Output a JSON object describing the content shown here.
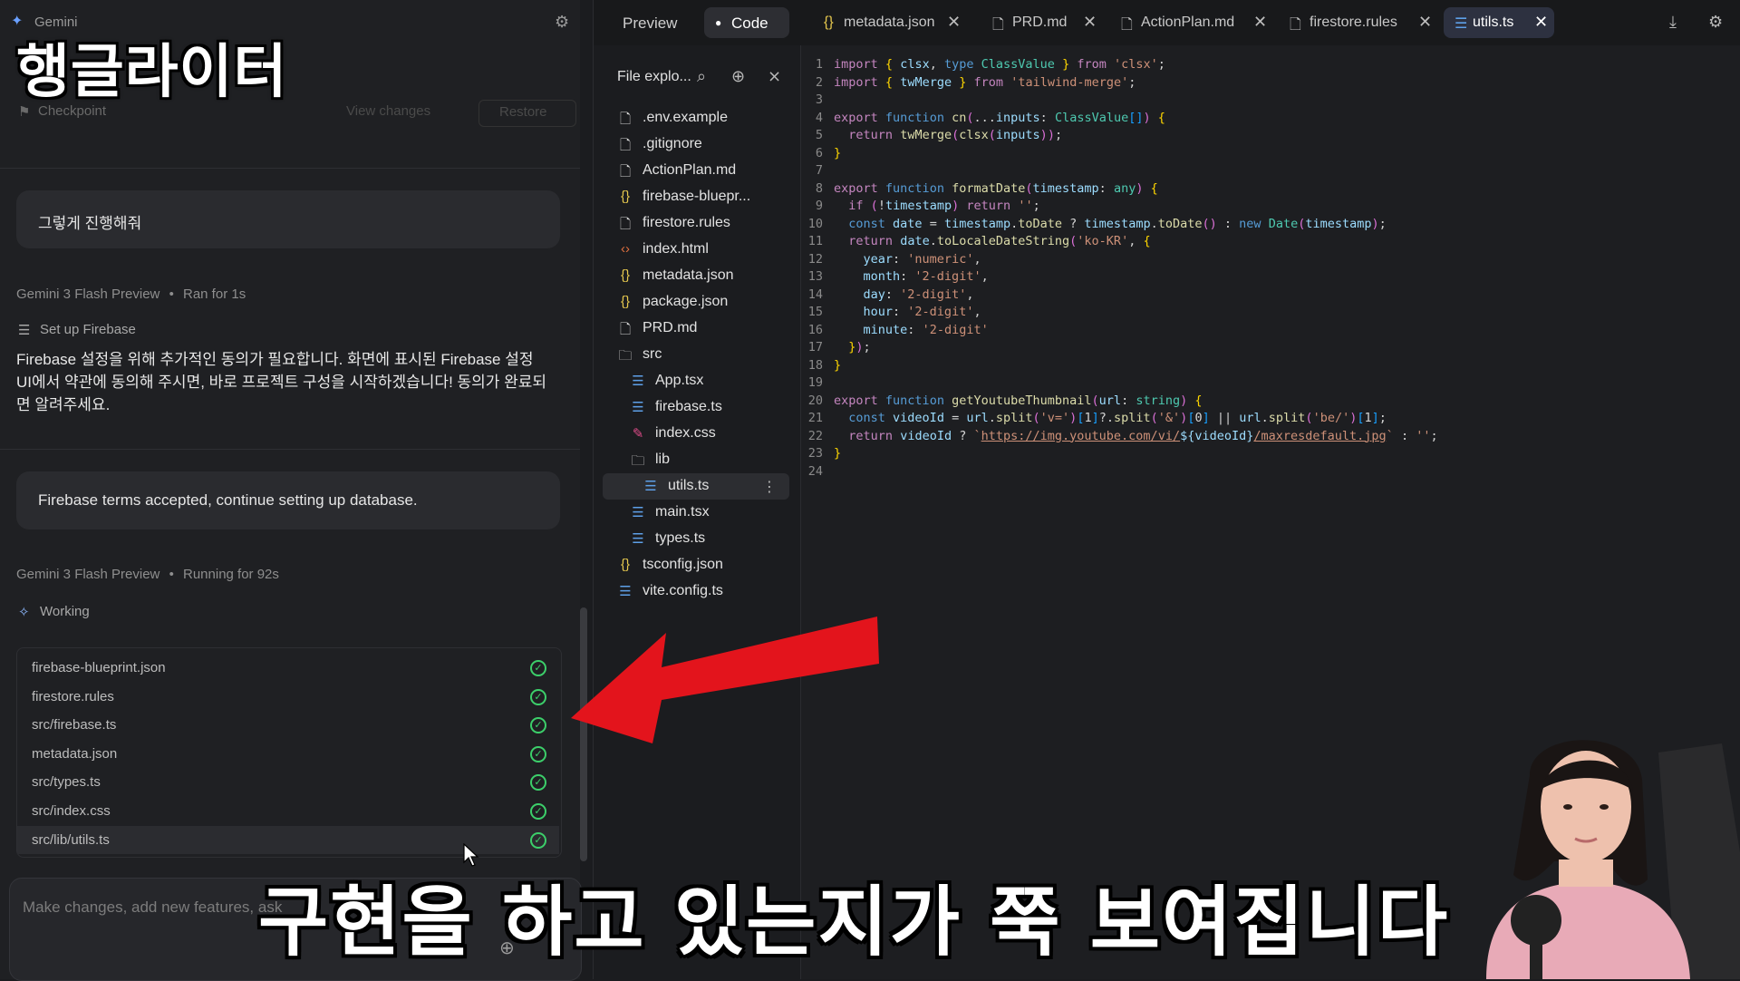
{
  "left_panel": {
    "app_name": "Gemini",
    "overlay_brand": "행글라이터",
    "checkpoint": {
      "label": "Checkpoint",
      "view_changes": "View changes",
      "restore": "Restore"
    },
    "user_msg_1": "그렇게 진행해줘",
    "run_1": {
      "model": "Gemini 3 Flash Preview",
      "separator": "•",
      "status": "Ran for 1s"
    },
    "step_1": "Set up Firebase",
    "assistant_text": [
      "Firebase 설정을 위해 추가적인 동의가 필요합니다. 화면에 표시된 Firebase 설정",
      "UI에서 약관에 동의해 주시면, 바로 프로젝트 구성을 시작하겠습니다! 동의가 완료되",
      "면 알려주세요."
    ],
    "user_msg_2": "Firebase terms accepted, continue setting up database.",
    "run_2": {
      "model": "Gemini 3 Flash Preview",
      "separator": "•",
      "status": "Running for 92s"
    },
    "working": "Working",
    "files": [
      "firebase-blueprint.json",
      "firestore.rules",
      "src/firebase.ts",
      "metadata.json",
      "src/types.ts",
      "src/index.css",
      "src/lib/utils.ts"
    ],
    "input_placeholder": "Make changes, add new features, ask"
  },
  "top_bar": {
    "preview_tab": "Preview",
    "code_tab": "Code",
    "file_tabs": [
      {
        "name": "metadata.json",
        "icon": "json-icon"
      },
      {
        "name": "PRD.md",
        "icon": "file-icon"
      },
      {
        "name": "ActionPlan.md",
        "icon": "file-icon"
      },
      {
        "name": "firestore.rules",
        "icon": "file-icon"
      },
      {
        "name": "utils.ts",
        "icon": "ts-icon"
      }
    ]
  },
  "explorer": {
    "title": "File explo...",
    "tree": [
      {
        "name": ".env.example",
        "type": "file"
      },
      {
        "name": ".gitignore",
        "type": "file"
      },
      {
        "name": "ActionPlan.md",
        "type": "file"
      },
      {
        "name": "firebase-bluepr...",
        "type": "json"
      },
      {
        "name": "firestore.rules",
        "type": "file"
      },
      {
        "name": "index.html",
        "type": "html"
      },
      {
        "name": "metadata.json",
        "type": "json"
      },
      {
        "name": "package.json",
        "type": "json"
      },
      {
        "name": "PRD.md",
        "type": "file"
      },
      {
        "name": "src",
        "type": "folder"
      },
      {
        "name": "App.tsx",
        "type": "ts"
      },
      {
        "name": "firebase.ts",
        "type": "ts"
      },
      {
        "name": "index.css",
        "type": "css"
      },
      {
        "name": "lib",
        "type": "folder"
      },
      {
        "name": "utils.ts",
        "type": "ts"
      },
      {
        "name": "main.tsx",
        "type": "ts"
      },
      {
        "name": "types.ts",
        "type": "ts"
      },
      {
        "name": "tsconfig.json",
        "type": "json"
      },
      {
        "name": "vite.config.ts",
        "type": "ts"
      }
    ]
  },
  "code_lines": [
    "import { clsx, type ClassValue } from 'clsx';",
    "import { twMerge } from 'tailwind-merge';",
    "",
    "export function cn(...inputs: ClassValue[]) {",
    "  return twMerge(clsx(inputs));",
    "}",
    "",
    "export function formatDate(timestamp: any) {",
    "  if (!timestamp) return '';",
    "  const date = timestamp.toDate ? timestamp.toDate() : new Date(timestamp);",
    "  return date.toLocaleDateString('ko-KR', {",
    "    year: 'numeric',",
    "    month: '2-digit',",
    "    day: '2-digit',",
    "    hour: '2-digit',",
    "    minute: '2-digit'",
    "  });",
    "}",
    "",
    "export function getYoutubeThumbnail(url: string) {",
    "  const videoId = url.split('v=')[1]?.split('&')[0] || url.split('be/')[1];",
    "  return videoId ? `https://img.youtube.com/vi/${videoId}/maxresdefault.jpg` : '';",
    "}",
    ""
  ],
  "subtitle": "구현을 하고 있는지가 쭉 보여집니다",
  "colors": {
    "accent_check": "#3ccf6a",
    "arrow": "#e3141c",
    "active_tab": "#2d3140"
  }
}
